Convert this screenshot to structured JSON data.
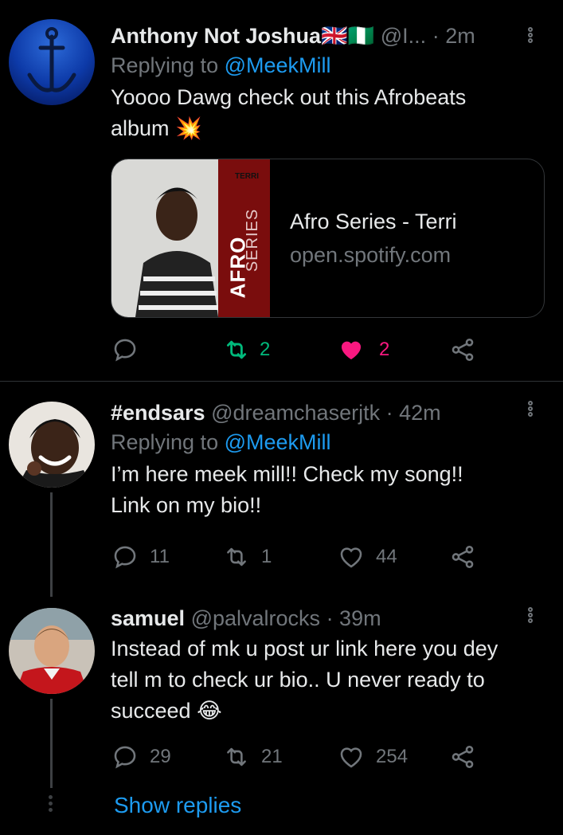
{
  "tweets": [
    {
      "display_name": "Anthony Not Joshua",
      "flags": "🇬🇧🇳🇬",
      "handle": "@I...",
      "time": "· 2m",
      "replying_prefix": "Replying to ",
      "replying_to": "@MeekMill",
      "text": "Yoooo Dawg check out this Afrobeats album 💥",
      "card": {
        "title": "Afro Series - Terri",
        "url": "open.spotify.com",
        "art_label_brand": "TERRI",
        "art_label_afro": "AFRO",
        "art_label_series": "SERIES"
      },
      "replies": "",
      "retweets": "2",
      "likes": "2",
      "liked": true
    },
    {
      "display_name": "#endsars",
      "handle": "@dreamchaserjtk",
      "time": "· 42m",
      "replying_prefix": "Replying to ",
      "replying_to": "@MeekMill",
      "text_line1": "I’m here meek mill!! Check my song!!",
      "text_line2": "Link on my bio!!",
      "replies": "11",
      "retweets": "1",
      "likes": "44"
    },
    {
      "display_name": "samuel",
      "handle": "@palvalrocks",
      "time": "· 39m",
      "text_line1": "Instead of mk u post ur link here you dey",
      "text_line2": "tell m to check ur bio.. U never ready to",
      "text_line3": "succeed 😂",
      "replies": "29",
      "retweets": "21",
      "likes": "254"
    }
  ],
  "show_replies": "Show replies",
  "colors": {
    "accent": "#1d9bf0",
    "retweet_active": "#00ba7c",
    "like_active": "#f91880",
    "muted": "#71767b",
    "background": "#000000"
  }
}
